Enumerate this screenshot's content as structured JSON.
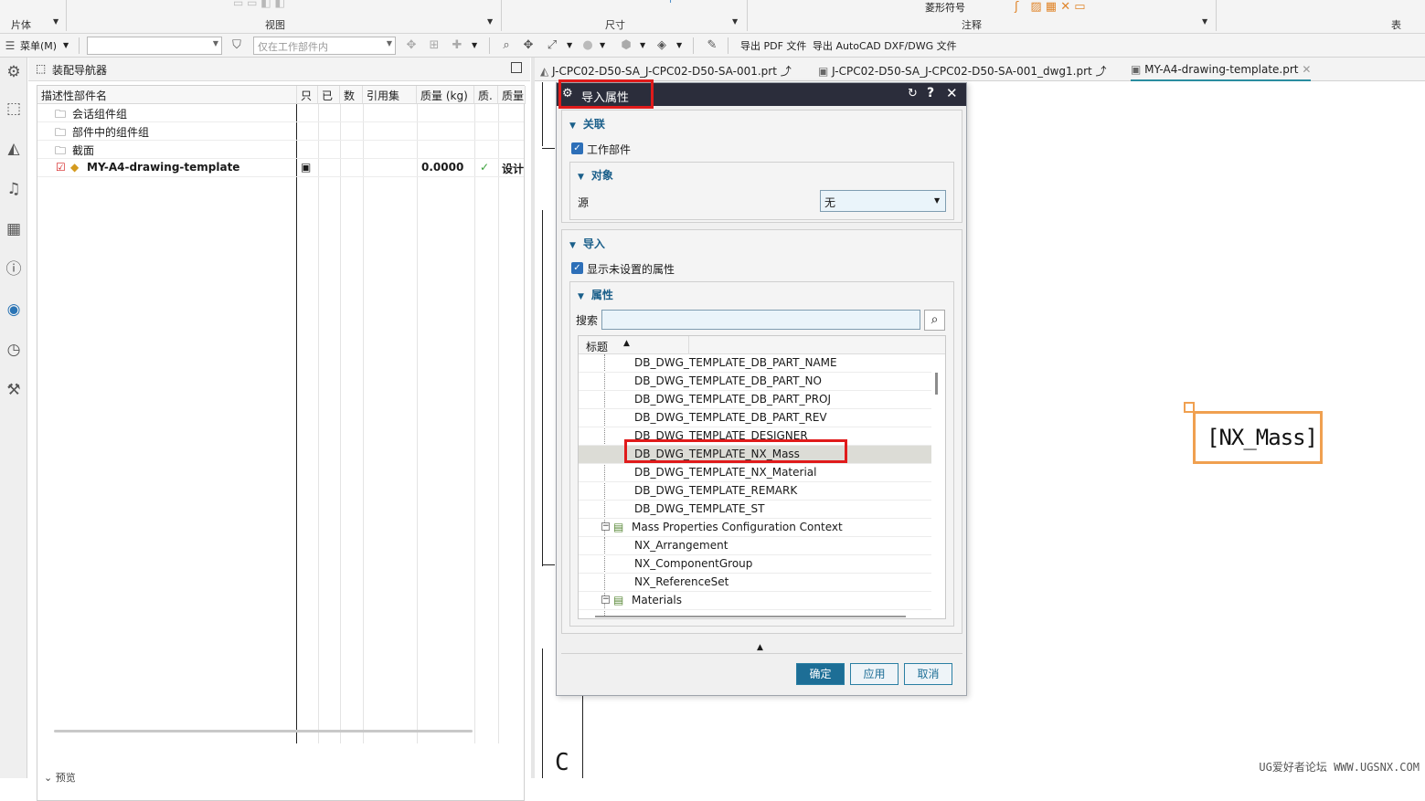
{
  "ribbon": {
    "groups": [
      {
        "label": "片体"
      },
      {
        "label": "视图"
      },
      {
        "label": "尺寸"
      },
      {
        "label": "注释"
      },
      {
        "label": "表"
      }
    ],
    "faded_top": "菱形符号"
  },
  "toolbar": {
    "menu_label": "菜单(M)",
    "combo1_value": "",
    "combo2_placeholder": "仅在工作部件内",
    "export_pdf": "导出 PDF 文件",
    "export_dwg": "导出 AutoCAD DXF/DWG 文件"
  },
  "navigator": {
    "title": "装配导航器",
    "columns": [
      "描述性部件名",
      "只",
      "已",
      "数",
      "引用集",
      "质量 (kg)",
      "质.",
      "质量"
    ],
    "rows": [
      {
        "name": "会话组件组",
        "icon": "folder-icon"
      },
      {
        "name": "部件中的组件组",
        "icon": "folder-icon"
      },
      {
        "name": "截面",
        "icon": "folder-icon"
      },
      {
        "name": "MY-A4-drawing-template",
        "icon": "part-icon",
        "mass": "0.0000",
        "status": "设计"
      }
    ],
    "bottom_label": "预览"
  },
  "tabs": [
    {
      "label": "J-CPC02-D50-SA_J-CPC02-D50-SA-001.prt"
    },
    {
      "label": "J-CPC02-D50-SA_J-CPC02-D50-SA-001_dwg1.prt"
    },
    {
      "label": "MY-A4-drawing-template.prt"
    }
  ],
  "dialog": {
    "title": "导入属性",
    "section_association": "关联",
    "work_part_label": "工作部件",
    "section_object": "对象",
    "source_label": "源",
    "source_value": "无",
    "section_import": "导入",
    "show_unset_label": "显示未设置的属性",
    "section_attributes": "属性",
    "search_label": "搜索",
    "list_header": "标题",
    "items": [
      {
        "text": "DB_DWG_TEMPLATE_DB_PART_NAME",
        "level": 2
      },
      {
        "text": "DB_DWG_TEMPLATE_DB_PART_NO",
        "level": 2
      },
      {
        "text": "DB_DWG_TEMPLATE_DB_PART_PROJ",
        "level": 2
      },
      {
        "text": "DB_DWG_TEMPLATE_DB_PART_REV",
        "level": 2
      },
      {
        "text": "DB_DWG_TEMPLATE_DESIGNER",
        "level": 2
      },
      {
        "text": "DB_DWG_TEMPLATE_NX_Mass",
        "level": 2,
        "selected": true
      },
      {
        "text": "DB_DWG_TEMPLATE_NX_Material",
        "level": 2
      },
      {
        "text": "DB_DWG_TEMPLATE_REMARK",
        "level": 2
      },
      {
        "text": "DB_DWG_TEMPLATE_ST",
        "level": 2
      },
      {
        "text": "Mass Properties Configuration Context",
        "level": 1
      },
      {
        "text": "NX_Arrangement",
        "level": 2
      },
      {
        "text": "NX_ComponentGroup",
        "level": 2
      },
      {
        "text": "NX_ReferenceSet",
        "level": 2
      },
      {
        "text": "Materials",
        "level": 1
      }
    ],
    "ok_label": "确定",
    "apply_label": "应用",
    "cancel_label": "取消"
  },
  "drawing": {
    "note_text": "[NX_Mass]",
    "border_letter": "C"
  },
  "watermark": "UG爱好者论坛 WWW.UGSNX.COM",
  "colors": {
    "highlight_red": "#e01b1b",
    "note_orange": "#f0a050",
    "dialog_title_bg": "#2b2d3b",
    "accent_blue": "#1d6e96"
  }
}
